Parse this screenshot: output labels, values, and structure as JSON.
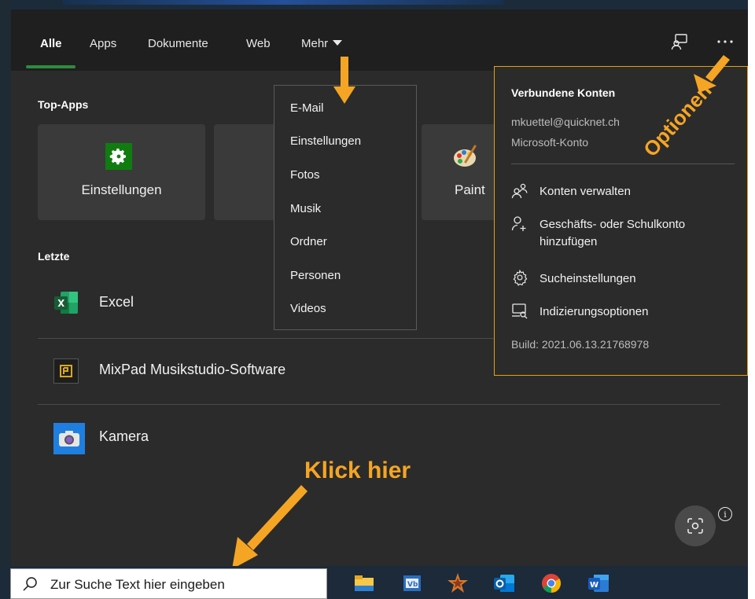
{
  "tabs": [
    "Alle",
    "Apps",
    "Dokumente",
    "Web",
    "Mehr"
  ],
  "sections": {
    "top_apps": "Top-Apps",
    "recent": "Letzte"
  },
  "top_apps": [
    "Einstellungen",
    "Paint"
  ],
  "recent": [
    "Excel",
    "MixPad Musikstudio-Software",
    "Kamera"
  ],
  "more_menu": [
    "E-Mail",
    "Einstellungen",
    "Fotos",
    "Musik",
    "Ordner",
    "Personen",
    "Videos"
  ],
  "options": {
    "title": "Verbundene Konten",
    "email": "mkuettel@quicknet.ch",
    "account_type": "Microsoft-Konto",
    "items": [
      {
        "icon": "manage-accounts-icon",
        "label": "Konten verwalten"
      },
      {
        "icon": "add-account-icon",
        "label": "Geschäfts- oder Schulkonto hinzufügen"
      },
      {
        "icon": "gear-icon",
        "label": "Sucheinstellungen"
      },
      {
        "icon": "indexing-icon",
        "label": "Indizierungsoptionen"
      }
    ],
    "build": "Build: 2021.06.13.21768978"
  },
  "annotations": {
    "click_here": "Klick hier",
    "options": "Optionen"
  },
  "taskbar": {
    "search_placeholder": "Zur Suche Text hier eingeben",
    "apps": [
      "file-explorer-icon",
      "virtualbox-icon",
      "paint-star-icon",
      "outlook-icon",
      "chrome-icon",
      "word-icon"
    ]
  },
  "colors": {
    "accent_tab": "#2e8b3f",
    "annotation": "#f5a524",
    "panel_bg": "#2b2b2b",
    "header_bg": "#1f1f1f"
  }
}
